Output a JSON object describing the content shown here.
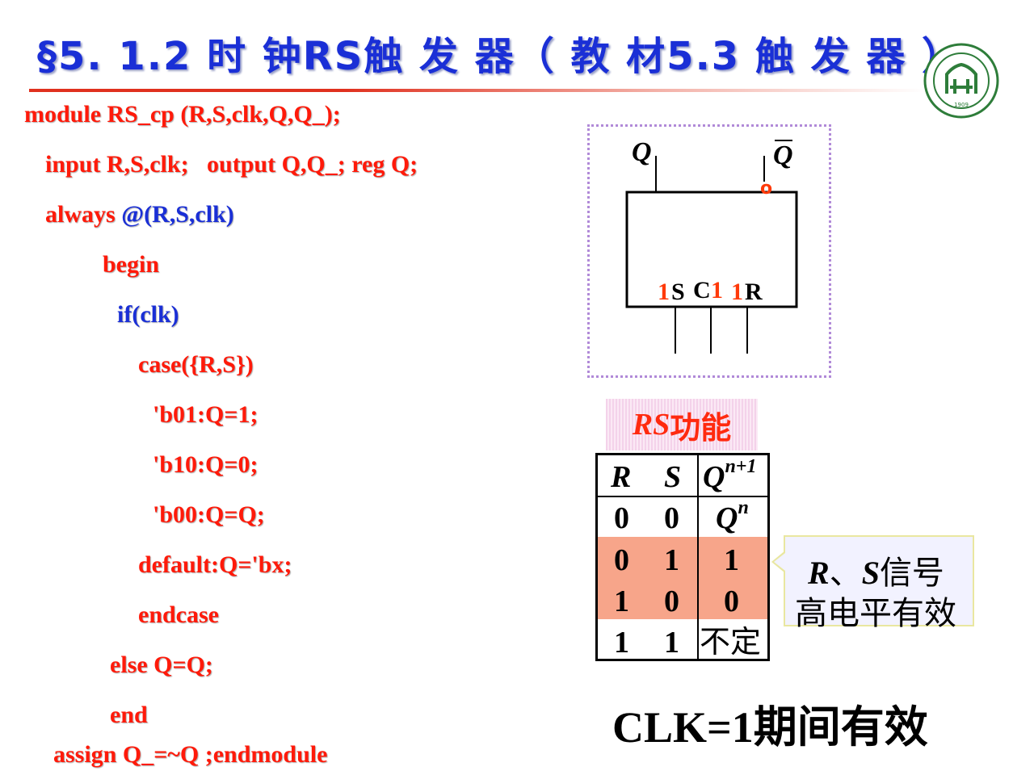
{
  "title": "§5. 1.2 时 钟RS触 发 器（ 教 材5.3 触 发 器 ）",
  "code_lines": [
    "module RS_cp (R,S,clk,Q,Q_);",
    "input R,S,clk;   output Q,Q_; reg Q;",
    "always ",
    "@(R,S,clk)",
    "begin",
    "if(clk)",
    "case({R,S})",
    "'b01:Q=1;",
    "'b10:Q=0;",
    "'b00:Q=Q;",
    "default:Q='bx;",
    "endcase",
    "else Q=Q;",
    "end",
    "assign Q_=~Q ;endmodule"
  ],
  "diagram": {
    "q_label": "Q",
    "qbar_label": "Q",
    "bubble": "o",
    "inputs": [
      {
        "num": "1",
        "name": "S"
      },
      {
        "name": "C",
        "num": "1"
      },
      {
        "num": "1",
        "name": "R"
      }
    ]
  },
  "function_label": {
    "italic": "RS",
    "text": "功能"
  },
  "truth_table": {
    "headers": {
      "r": "R",
      "s": "S",
      "q": "Q",
      "q_sup": "n+1"
    },
    "rows": [
      {
        "r": "0",
        "s": "0",
        "q": "Q",
        "q_sup": "n"
      },
      {
        "r": "0",
        "s": "1",
        "q": "1"
      },
      {
        "r": "1",
        "s": "0",
        "q": "0"
      },
      {
        "r": "1",
        "s": "1",
        "q": "不定"
      }
    ],
    "highlight_color": "#f7a58a"
  },
  "callout": {
    "r": "R",
    "sep": "、",
    "s": "S",
    "text1": "信号",
    "line2": "高电平有效"
  },
  "clk_note": "CLK=1期间有效",
  "logo_text": "1909",
  "colors": {
    "title": "#1a2fd6",
    "code": "#ff1a0a",
    "accent": "#ff2a0f",
    "logo": "#2e7d3a"
  }
}
